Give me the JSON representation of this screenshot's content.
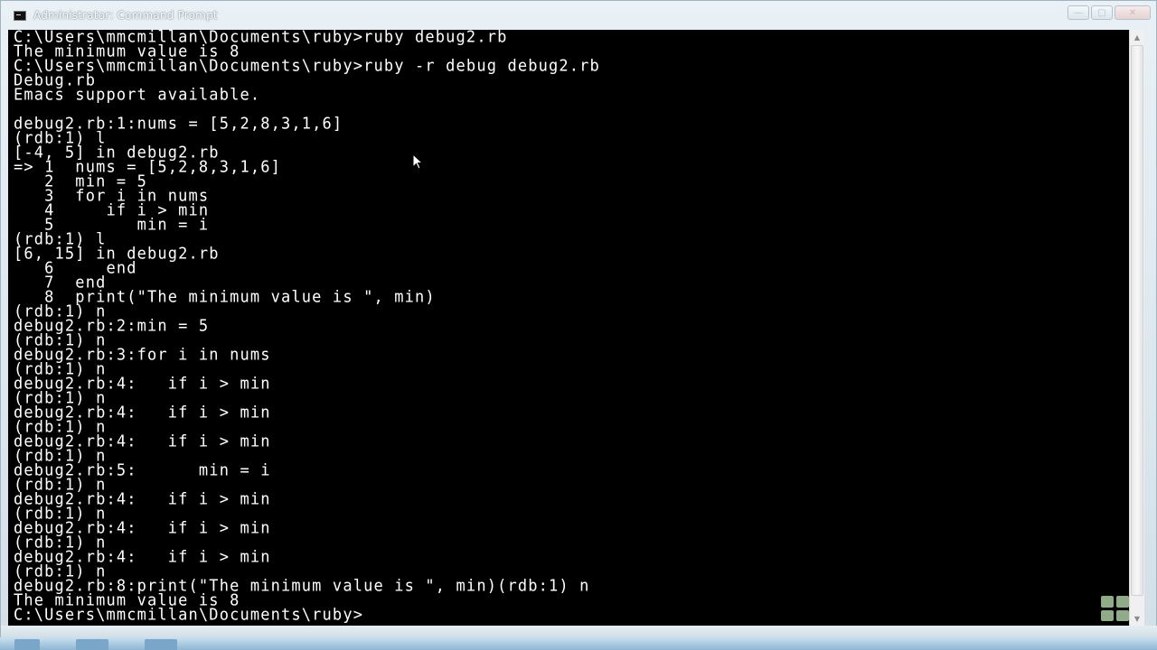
{
  "window": {
    "title": "Administrator: Command Prompt",
    "minimize_glyph": "—",
    "maximize_glyph": "▢",
    "close_glyph": "✕"
  },
  "scrollbar": {
    "up_glyph": "▲",
    "down_glyph": "▼"
  },
  "console": {
    "lines": [
      "C:\\Users\\mmcmillan\\Documents\\ruby>ruby debug2.rb",
      "The minimum value is 8",
      "C:\\Users\\mmcmillan\\Documents\\ruby>ruby -r debug debug2.rb",
      "Debug.rb",
      "Emacs support available.",
      "",
      "debug2.rb:1:nums = [5,2,8,3,1,6]",
      "(rdb:1) l",
      "[-4, 5] in debug2.rb",
      "=> 1  nums = [5,2,8,3,1,6]",
      "   2  min = 5",
      "   3  for i in nums",
      "   4     if i > min",
      "   5        min = i",
      "(rdb:1) l",
      "[6, 15] in debug2.rb",
      "   6     end",
      "   7  end",
      "   8  print(\"The minimum value is \", min)",
      "(rdb:1) n",
      "debug2.rb:2:min = 5",
      "(rdb:1) n",
      "debug2.rb:3:for i in nums",
      "(rdb:1) n",
      "debug2.rb:4:   if i > min",
      "(rdb:1) n",
      "debug2.rb:4:   if i > min",
      "(rdb:1) n",
      "debug2.rb:4:   if i > min",
      "(rdb:1) n",
      "debug2.rb:5:      min = i",
      "(rdb:1) n",
      "debug2.rb:4:   if i > min",
      "(rdb:1) n",
      "debug2.rb:4:   if i > min",
      "(rdb:1) n",
      "debug2.rb:4:   if i > min",
      "(rdb:1) n",
      "debug2.rb:8:print(\"The minimum value is \", min)(rdb:1) n",
      "The minimum value is 8",
      "C:\\Users\\mmcmillan\\Documents\\ruby>"
    ]
  }
}
